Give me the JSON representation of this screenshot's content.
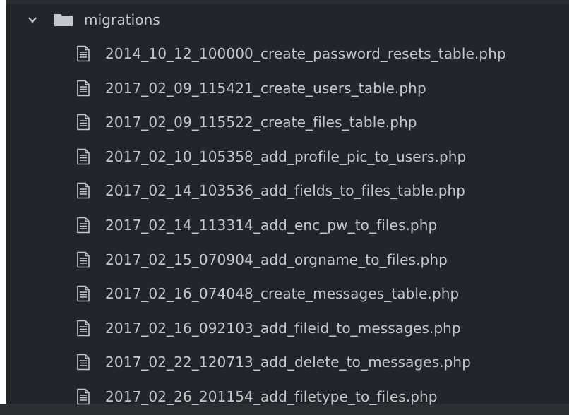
{
  "tree": {
    "folder": {
      "name": "migrations",
      "expanded": true,
      "chevron_icon": "chevron-down-icon",
      "folder_icon": "folder-icon"
    },
    "file_icon": "file-text-icon",
    "files": [
      "2014_10_12_100000_create_password_resets_table.php",
      "2017_02_09_115421_create_users_table.php",
      "2017_02_09_115522_create_files_table.php",
      "2017_02_10_105358_add_profile_pic_to_users.php",
      "2017_02_14_103536_add_fields_to_files_table.php",
      "2017_02_14_113314_add_enc_pw_to_files.php",
      "2017_02_15_070904_add_orgname_to_files.php",
      "2017_02_16_074048_create_messages_table.php",
      "2017_02_16_092103_add_fileid_to_messages.php",
      "2017_02_22_120713_add_delete_to_messages.php",
      "2017_02_26_201154_add_filetype_to_files.php"
    ]
  },
  "colors": {
    "background": "#23252a",
    "text": "#c4c8ce",
    "icon": "#c4c8ce"
  }
}
